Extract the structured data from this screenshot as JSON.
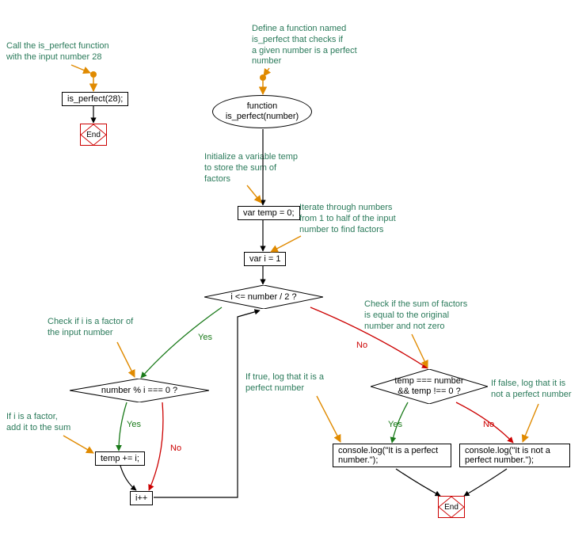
{
  "comments": {
    "call_fn": "Call the is_perfect function\nwith the input number 28",
    "define_fn": "Define a function named\nis_perfect that checks if\na given number is a perfect\nnumber",
    "init_temp": "Initialize a variable temp\nto store the sum of\nfactors",
    "iterate": "Iterate through numbers\nfrom 1 to half of the input\nnumber to find factors",
    "check_factor": "Check if i is a factor of\nthe input number",
    "add_to_sum": "If i is a factor,\nadd it to the sum",
    "check_sum": "Check if the sum of factors\nis equal to the original\nnumber and not zero",
    "if_true": "If true, log that it is a\nperfect number",
    "if_false": "If false, log that it is\nnot a perfect number"
  },
  "nodes": {
    "call_stmt": "is_perfect(28);",
    "func_decl": "function\nis_perfect(number)",
    "temp_init": "var temp = 0;",
    "i_init": "var i = 1",
    "loop_cond": "i <= number / 2 ?",
    "mod_cond": "number % i === 0 ?",
    "temp_add": "temp += i;",
    "i_inc": "i++",
    "sum_cond": "temp === number\n&& temp !== 0 ?",
    "log_true": "console.log(\"It is a perfect\nnumber.\");",
    "log_false": "console.log(\"It is not a\nperfect number.\");",
    "end": "End"
  },
  "labels": {
    "yes": "Yes",
    "no": "No"
  },
  "chart_data": {
    "type": "flowchart",
    "nodes": [
      {
        "id": "start_left",
        "type": "start",
        "label": ""
      },
      {
        "id": "call_stmt",
        "type": "process",
        "label": "is_perfect(28);"
      },
      {
        "id": "end_left",
        "type": "end",
        "label": "End"
      },
      {
        "id": "start_right",
        "type": "start",
        "label": ""
      },
      {
        "id": "func_decl",
        "type": "terminator",
        "label": "function is_perfect(number)"
      },
      {
        "id": "temp_init",
        "type": "process",
        "label": "var temp = 0;"
      },
      {
        "id": "i_init",
        "type": "process",
        "label": "var i = 1"
      },
      {
        "id": "loop_cond",
        "type": "decision",
        "label": "i <= number / 2 ?"
      },
      {
        "id": "mod_cond",
        "type": "decision",
        "label": "number % i === 0 ?"
      },
      {
        "id": "temp_add",
        "type": "process",
        "label": "temp += i;"
      },
      {
        "id": "i_inc",
        "type": "process",
        "label": "i++"
      },
      {
        "id": "sum_cond",
        "type": "decision",
        "label": "temp === number && temp !== 0 ?"
      },
      {
        "id": "log_true",
        "type": "process",
        "label": "console.log(\"It is a perfect number.\");"
      },
      {
        "id": "log_false",
        "type": "process",
        "label": "console.log(\"It is not a perfect number.\");"
      },
      {
        "id": "end_right",
        "type": "end",
        "label": "End"
      }
    ],
    "edges": [
      {
        "from": "start_left",
        "to": "call_stmt"
      },
      {
        "from": "call_stmt",
        "to": "end_left"
      },
      {
        "from": "start_right",
        "to": "func_decl"
      },
      {
        "from": "func_decl",
        "to": "temp_init"
      },
      {
        "from": "temp_init",
        "to": "i_init"
      },
      {
        "from": "i_init",
        "to": "loop_cond"
      },
      {
        "from": "loop_cond",
        "to": "mod_cond",
        "label": "Yes"
      },
      {
        "from": "loop_cond",
        "to": "sum_cond",
        "label": "No"
      },
      {
        "from": "mod_cond",
        "to": "temp_add",
        "label": "Yes"
      },
      {
        "from": "mod_cond",
        "to": "i_inc",
        "label": "No"
      },
      {
        "from": "temp_add",
        "to": "i_inc"
      },
      {
        "from": "i_inc",
        "to": "loop_cond"
      },
      {
        "from": "sum_cond",
        "to": "log_true",
        "label": "Yes"
      },
      {
        "from": "sum_cond",
        "to": "log_false",
        "label": "No"
      },
      {
        "from": "log_true",
        "to": "end_right"
      },
      {
        "from": "log_false",
        "to": "end_right"
      }
    ],
    "annotations": [
      {
        "target": "call_stmt",
        "text": "Call the is_perfect function with the input number 28"
      },
      {
        "target": "func_decl",
        "text": "Define a function named is_perfect that checks if a given number is a perfect number"
      },
      {
        "target": "temp_init",
        "text": "Initialize a variable temp to store the sum of factors"
      },
      {
        "target": "i_init",
        "text": "Iterate through numbers from 1 to half of the input number to find factors"
      },
      {
        "target": "mod_cond",
        "text": "Check if i is a factor of the input number"
      },
      {
        "target": "temp_add",
        "text": "If i is a factor, add it to the sum"
      },
      {
        "target": "sum_cond",
        "text": "Check if the sum of factors is equal to the original number and not zero"
      },
      {
        "target": "log_true",
        "text": "If true, log that it is a perfect number"
      },
      {
        "target": "log_false",
        "text": "If false, log that it is not a perfect number"
      }
    ]
  }
}
